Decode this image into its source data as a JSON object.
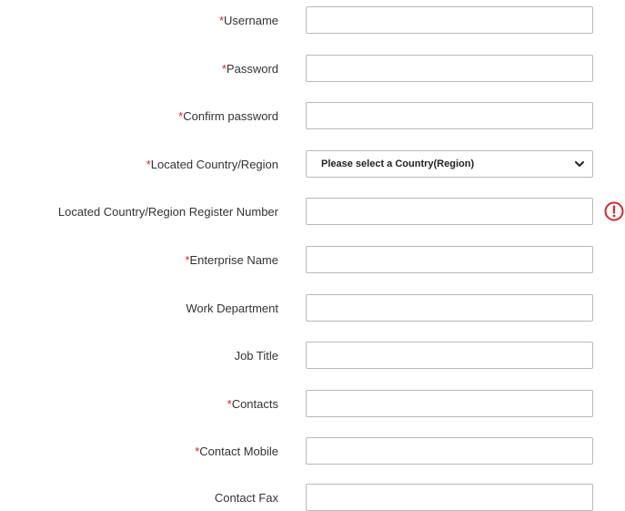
{
  "form": {
    "fields": [
      {
        "id": "username",
        "label": "Username",
        "required": true,
        "type": "text",
        "value": ""
      },
      {
        "id": "password",
        "label": "Password",
        "required": true,
        "type": "password",
        "value": ""
      },
      {
        "id": "confirm-password",
        "label": "Confirm password",
        "required": true,
        "type": "password",
        "value": ""
      },
      {
        "id": "country-region",
        "label": "Located Country/Region",
        "required": true,
        "type": "select",
        "selected": "Please select a Country(Region)"
      },
      {
        "id": "register-number",
        "label": "Located Country/Region Register Number",
        "required": false,
        "type": "text",
        "value": "",
        "warning_icon": "exclamation-circle-icon"
      },
      {
        "id": "enterprise-name",
        "label": "Enterprise Name",
        "required": true,
        "type": "text",
        "value": ""
      },
      {
        "id": "work-department",
        "label": "Work Department",
        "required": false,
        "type": "text",
        "value": ""
      },
      {
        "id": "job-title",
        "label": "Job Title",
        "required": false,
        "type": "text",
        "value": ""
      },
      {
        "id": "contacts",
        "label": "Contacts",
        "required": true,
        "type": "text",
        "value": ""
      },
      {
        "id": "contact-mobile",
        "label": "Contact Mobile",
        "required": true,
        "type": "text",
        "value": ""
      },
      {
        "id": "contact-fax",
        "label": "Contact Fax",
        "required": false,
        "type": "text",
        "value": ""
      }
    ],
    "required_marker": "*"
  },
  "colors": {
    "required": "#e0201f",
    "warning": "#d8262a",
    "border": "#b9b9b9",
    "label": "#333333"
  }
}
